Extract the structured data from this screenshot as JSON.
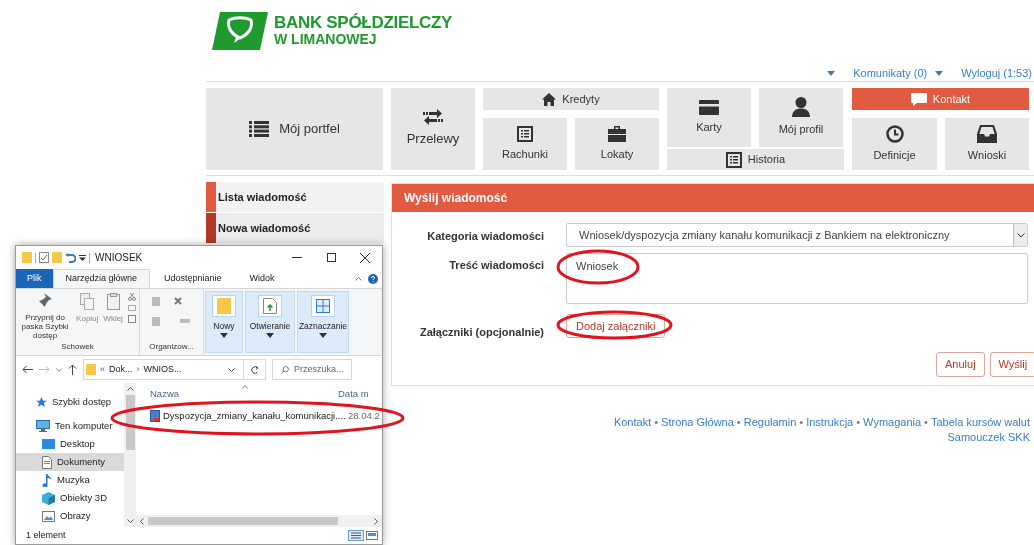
{
  "logo": {
    "line_1": "BANK SPÓŁDZIELCZY",
    "line_2": "W LIMANOWEJ"
  },
  "top_links": [
    {
      "kind": "caret"
    },
    {
      "kind": "dropdown",
      "label": "Komunikaty (0)"
    },
    {
      "kind": "link",
      "label": "Wyloguj (1:53)"
    }
  ],
  "nav": [
    {
      "label": "Mój portfel",
      "selected": false
    },
    {
      "label": "Przelewy",
      "selected": false
    },
    {
      "label": "Kredyty",
      "selected": false
    },
    {
      "label": "Rachunki",
      "selected": false
    },
    {
      "label": "Lokaty",
      "selected": false
    },
    {
      "label": "Karty",
      "selected": false
    },
    {
      "label": "Mój profil",
      "selected": false
    },
    {
      "label": "Historia",
      "selected": false
    },
    {
      "label": "Kontakt",
      "selected": true
    },
    {
      "label": "Definicje",
      "selected": false
    },
    {
      "label": "Wnioski",
      "selected": false
    }
  ],
  "sidebar": {
    "items": [
      {
        "label": "Lista wiadomość",
        "selected": false
      },
      {
        "label": "Nowa wiadomość",
        "selected": true
      }
    ]
  },
  "form": {
    "title": "Wyślij wiadomość",
    "category": {
      "label": "Kategoria wiadomości",
      "value": "Wniosek/dyspozycja zmiany kanału komunikacji z Bankiem na elektroniczny"
    },
    "content": {
      "label": "Treść wiadomości",
      "value": "Wniosek"
    },
    "attachments": {
      "label": "Załączniki (opcjonalnie)",
      "button": "Dodaj załączniki"
    },
    "buttons": [
      "Anuluj",
      "Wyślij"
    ]
  },
  "footer": {
    "links": [
      "Kontakt",
      "Strona Główna",
      "Regulamin",
      "Instrukcja",
      "Wymagania",
      "Tabela kursów walut"
    ],
    "separator": "•",
    "second_line": "Samouczek SKK"
  },
  "explorer": {
    "title": "WNIOSEK",
    "tabs": [
      {
        "label": "Plik",
        "kind": "file",
        "selected": false
      },
      {
        "label": "Narzędzia główne",
        "kind": "tab",
        "selected": true
      },
      {
        "label": "Udostępnianie",
        "kind": "tab",
        "selected": false
      },
      {
        "label": "Widok",
        "kind": "tab",
        "selected": false
      }
    ],
    "clipboard": {
      "pin": "Przypnij do paska Szybki dostęp",
      "copy": "Kopiuj",
      "paste": "Wklej",
      "group": "Schowek"
    },
    "organize_group": "Organizow...",
    "big_buttons": [
      "Nowy",
      "Otwieranie",
      "Zaznaczanie"
    ],
    "address": {
      "prefix": "«",
      "parts": [
        "Dok...",
        "WNIOS..."
      ],
      "separator": "›"
    },
    "search_placeholder": "Przeszuka...",
    "nav_pane": [
      {
        "label": "Szybki dostęp",
        "selected": false
      },
      {
        "label": "Ten komputer",
        "selected": false
      },
      {
        "label": "Desktop",
        "selected": false
      },
      {
        "label": "Dokumenty",
        "selected": true
      },
      {
        "label": "Muzyka",
        "selected": false
      },
      {
        "label": "Obiekty 3D",
        "selected": false
      },
      {
        "label": "Obrazy",
        "selected": false
      }
    ],
    "columns": [
      "Nazwa",
      "Data m"
    ],
    "files": [
      {
        "name": "Dyspozycja_zmiany_kanału_komunikacji....",
        "date": "28.04.2"
      }
    ],
    "status": "1 element"
  }
}
